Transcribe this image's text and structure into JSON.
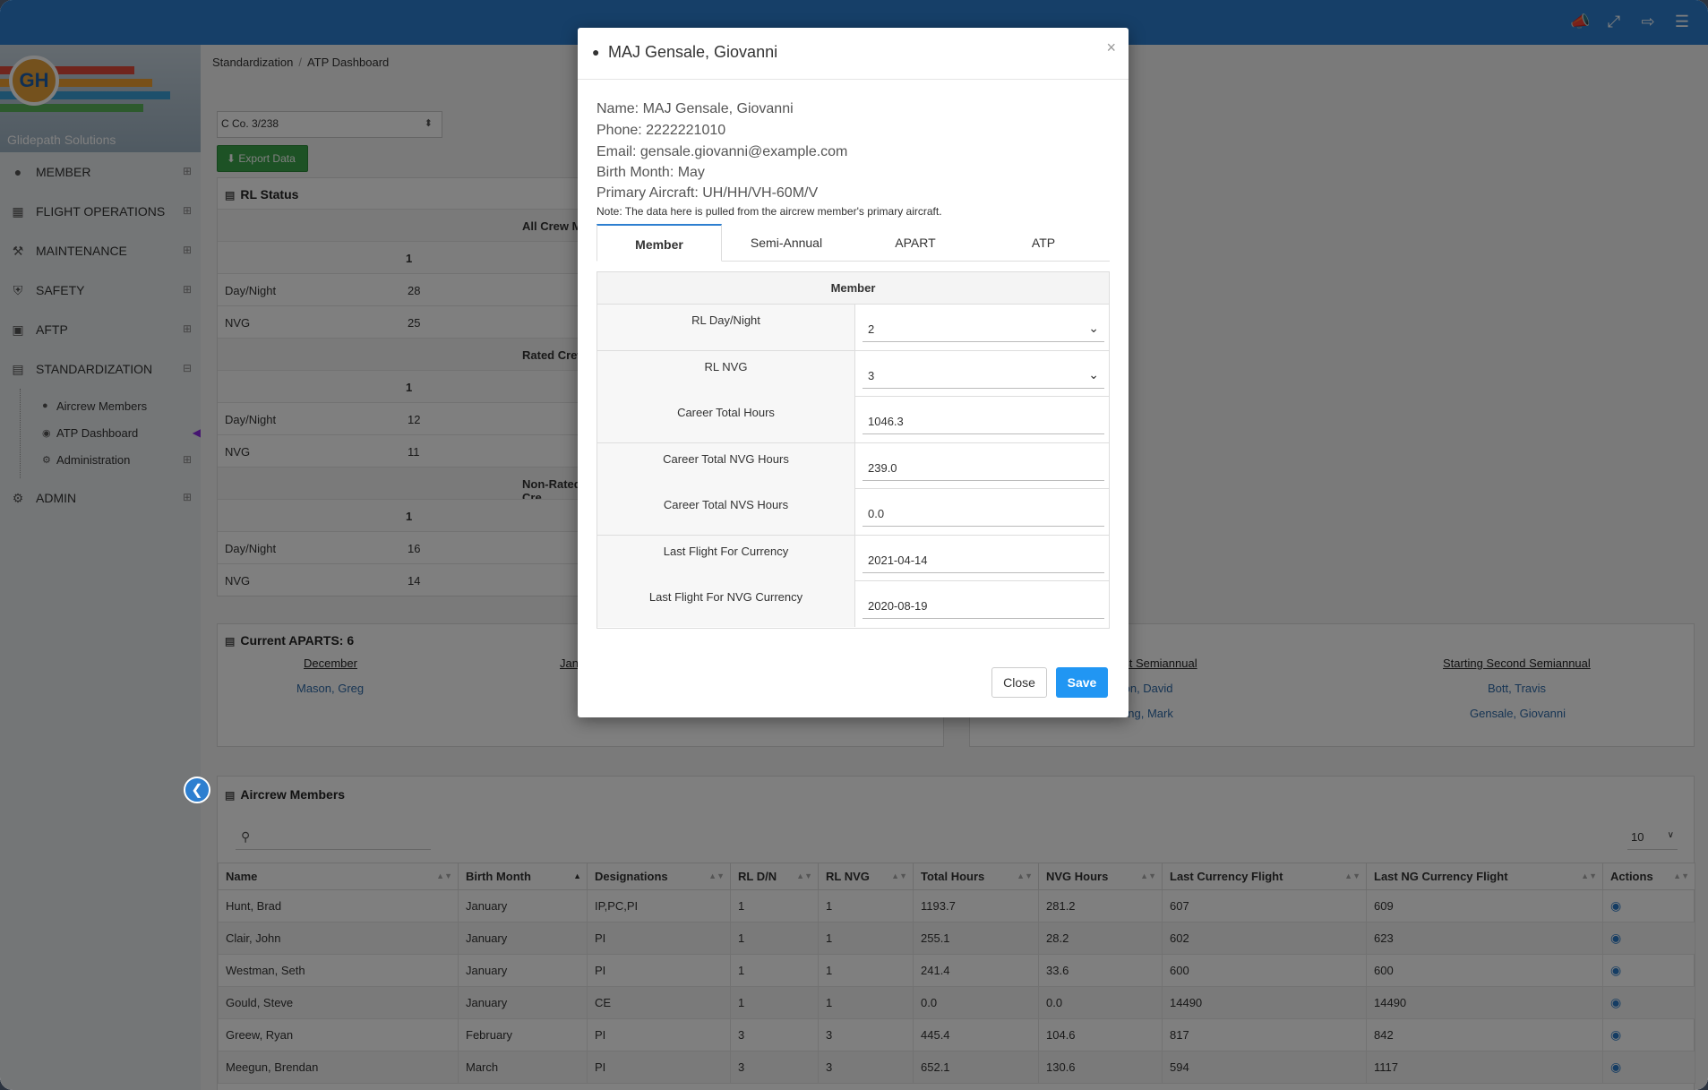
{
  "topbar": {
    "icons": [
      "megaphone-icon",
      "fullscreen-icon",
      "signout-icon",
      "menu-icon"
    ]
  },
  "sidebar": {
    "brand": "Glidepath Solutions",
    "items": [
      {
        "label": "MEMBER",
        "icon": "user-icon"
      },
      {
        "label": "FLIGHT OPERATIONS",
        "icon": "calendar-icon"
      },
      {
        "label": "MAINTENANCE",
        "icon": "wrench-icon"
      },
      {
        "label": "SAFETY",
        "icon": "shield-icon"
      },
      {
        "label": "AFTP",
        "icon": "money-icon"
      },
      {
        "label": "STANDARDIZATION",
        "icon": "book-icon"
      },
      {
        "label": "ADMIN",
        "icon": "gears-icon"
      }
    ],
    "sub_items": [
      {
        "label": "Aircrew Members"
      },
      {
        "label": "ATP Dashboard"
      },
      {
        "label": "Administration"
      }
    ]
  },
  "breadcrumb": {
    "root": "Standardization",
    "current": "ATP Dashboard"
  },
  "unit_select": "C Co. 3/238",
  "export_label": "Export Data",
  "rl_status": {
    "title": "RL Status",
    "sections": [
      {
        "header": "All Crew M",
        "col": "1",
        "rows": [
          {
            "label": "Day/Night",
            "value": "28"
          },
          {
            "label": "NVG",
            "value": "25"
          }
        ]
      },
      {
        "header": "Rated Crew",
        "col": "1",
        "rows": [
          {
            "label": "Day/Night",
            "value": "12"
          },
          {
            "label": "NVG",
            "value": "11"
          }
        ]
      },
      {
        "header": "Non-Rated Cre",
        "col": "1",
        "rows": [
          {
            "label": "Day/Night",
            "value": "16"
          },
          {
            "label": "NVG",
            "value": "14"
          }
        ]
      }
    ]
  },
  "aparts": {
    "title": "Current APARTS: 6",
    "left": {
      "col1_head": "December",
      "col1_items": [
        "Mason, Greg"
      ],
      "col2_head": "Jan"
    },
    "right": {
      "col1_head": "irst Semiannual",
      "col1_items": [
        "ton, David",
        "wing, Mark"
      ],
      "col2_head": "Starting Second Semiannual",
      "col2_items": [
        "Bott, Travis",
        "Gensale, Giovanni"
      ]
    }
  },
  "aircrew": {
    "title": "Aircrew Members",
    "page_size": "10",
    "columns": [
      "Name",
      "Birth Month",
      "Designations",
      "RL D/N",
      "RL NVG",
      "Total Hours",
      "NVG Hours",
      "Last Currency Flight",
      "Last NG Currency Flight",
      "Actions"
    ],
    "rows": [
      [
        "Hunt, Brad",
        "January",
        "IP,PC,PI",
        "1",
        "1",
        "1193.7",
        "281.2",
        "607",
        "609"
      ],
      [
        "Clair, John",
        "January",
        "PI",
        "1",
        "1",
        "255.1",
        "28.2",
        "602",
        "623"
      ],
      [
        "Westman, Seth",
        "January",
        "PI",
        "1",
        "1",
        "241.4",
        "33.6",
        "600",
        "600"
      ],
      [
        "Gould, Steve",
        "January",
        "CE",
        "1",
        "1",
        "0.0",
        "0.0",
        "14490",
        "14490"
      ],
      [
        "Greew, Ryan",
        "February",
        "PI",
        "3",
        "3",
        "445.4",
        "104.6",
        "817",
        "842"
      ],
      [
        "Meegun, Brendan",
        "March",
        "PI",
        "3",
        "3",
        "652.1",
        "130.6",
        "594",
        "1117"
      ]
    ]
  },
  "modal": {
    "title": "MAJ Gensale, Giovanni",
    "close_x": "×",
    "info": {
      "name": "Name: MAJ Gensale, Giovanni",
      "phone": "Phone: 2222221010",
      "email": "Email: gensale.giovanni@example.com",
      "birth": "Birth Month: May",
      "aircraft": "Primary Aircraft: UH/HH/VH-60M/V"
    },
    "note": "Note: The data here is pulled from the aircrew member's primary aircraft.",
    "tabs": [
      "Member",
      "Semi-Annual",
      "APART",
      "ATP"
    ],
    "table_head": "Member",
    "fields": [
      {
        "label": "RL Day/Night",
        "value": "2",
        "select": true
      },
      {
        "label": "RL NVG",
        "value": "3",
        "select": true
      },
      {
        "label": "Career Total Hours",
        "value": "1046.3"
      },
      {
        "label": "Career Total NVG Hours",
        "value": "239.0"
      },
      {
        "label": "Career Total NVS Hours",
        "value": "0.0"
      },
      {
        "label": "Last Flight For Currency",
        "value": "2021-04-14"
      },
      {
        "label": "Last Flight For NVG Currency",
        "value": "2020-08-19"
      }
    ],
    "close_label": "Close",
    "save_label": "Save"
  }
}
